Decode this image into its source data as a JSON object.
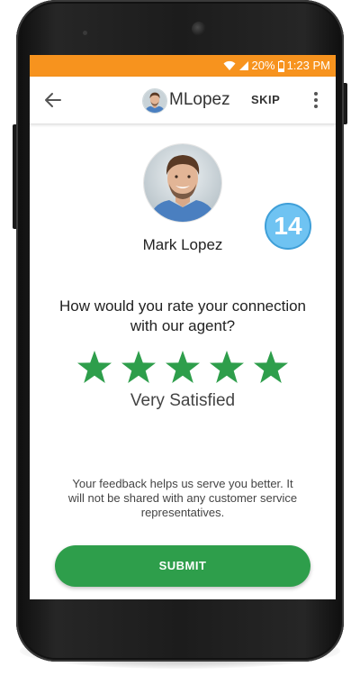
{
  "status_bar": {
    "battery_percent": "20%",
    "time": "1:23 PM",
    "color": "#f7931e"
  },
  "appbar": {
    "back_icon": "arrow-left-icon",
    "agent_username": "MLopez",
    "skip_label": "SKIP",
    "more_icon": "more-vertical-icon"
  },
  "agent": {
    "name": "Mark Lopez",
    "badge_count": "14"
  },
  "survey": {
    "question": "How would you rate your connection with our agent?",
    "rating": 5,
    "max_rating": 5,
    "rating_label": "Very Satisfied",
    "star_color": "#2e9e4b",
    "feedback_note": "Your feedback helps us serve you better. It will not be shared with any customer service representatives."
  },
  "submit": {
    "label": "SUBMIT",
    "color": "#2e9e4b"
  }
}
